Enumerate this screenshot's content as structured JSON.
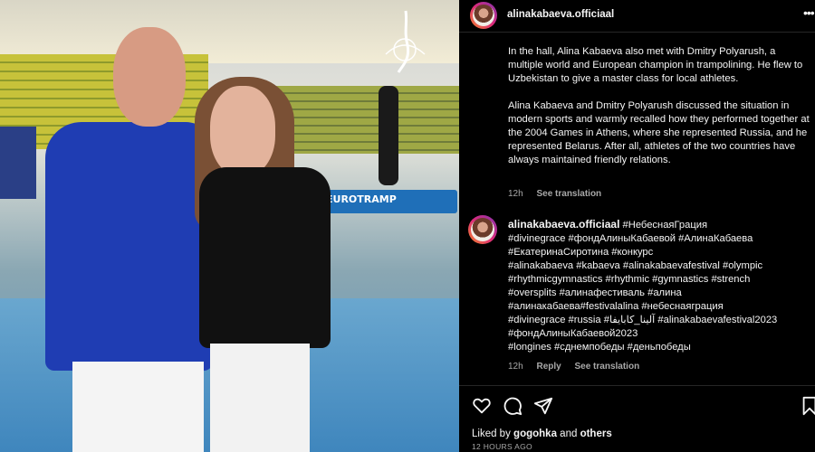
{
  "header": {
    "username": "alinakabaeva.officiaal",
    "more_icon": "more-horizontal-icon"
  },
  "photo": {
    "trampoline_text": "EUROTRAMP"
  },
  "caption": {
    "paragraphs": [
      "In the hall, Alina Kabaeva also met with Dmitry Polyarush, a multiple world and European champion in trampolining. He flew to Uzbekistan to give a master class for local athletes.",
      "Alina Kabaeva and Dmitry Polyarush discussed the situation in modern sports and warmly recalled how they performed together at the 2004 Games in Athens, where she represented Russia, and he represented Belarus. After all, athletes of the two countries have always maintained friendly relations."
    ],
    "meta": {
      "time": "12h",
      "see_translation": "See translation"
    }
  },
  "comment": {
    "username": "alinakabaeva.officiaal",
    "lines": [
      "#НебеснаяГрация",
      "#divinegrace #фондАлиныКабаевой #АлинаКабаева",
      "#ЕкатеринаСиротина #конкурс",
      "#alinakabaeva #kabaeva #alinakabaevafestival #olympic",
      "#rhythmicgymnastics #rhythmic #gymnastics #strench",
      "#oversplits #алинафестиваль #алина",
      "#алинакабаева#festivalalina #небеснаяграция",
      "#divinegrace #russia #آلينا_كابايفا #alinakabaevafestival2023",
      "#фондАлиныКабаевой2023",
      "#longines #сднемпобеды #деньпобеды"
    ],
    "meta": {
      "time": "12h",
      "reply": "Reply",
      "see_translation": "See translation"
    }
  },
  "actions": [
    "heart-icon",
    "comment-icon",
    "share-icon",
    "bookmark-icon"
  ],
  "likes": {
    "prefix": "Liked by",
    "user": "gogohka",
    "and": "and",
    "others": "others"
  },
  "timestamp": "12 HOURS AGO",
  "colors": {
    "background": "#000000",
    "text": "#f5f5f5",
    "muted": "#a8a8a8",
    "divider": "#262626"
  }
}
